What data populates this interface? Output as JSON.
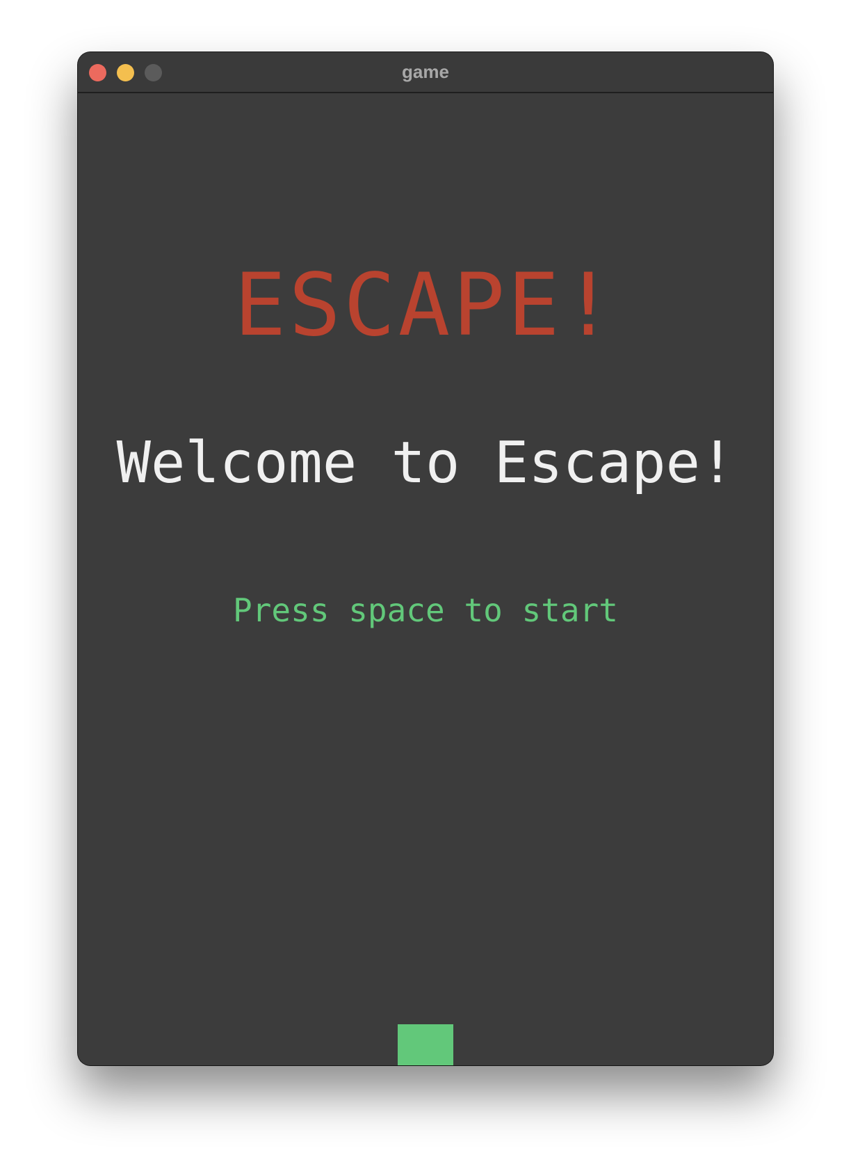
{
  "window": {
    "title": "game",
    "buttons": [
      {
        "name": "close",
        "color": "#ec6a5e"
      },
      {
        "name": "minimize",
        "color": "#f4bf4f"
      },
      {
        "name": "maximize",
        "color": "#5b5b5b"
      }
    ]
  },
  "game": {
    "title": "ESCAPE!",
    "welcome": "Welcome to Escape!",
    "prompt": "Press space to start",
    "colors": {
      "background": "#3c3c3c",
      "title": "#b9432f",
      "welcome": "#f0f0f0",
      "prompt": "#62c87a",
      "player": "#62c87a"
    }
  }
}
